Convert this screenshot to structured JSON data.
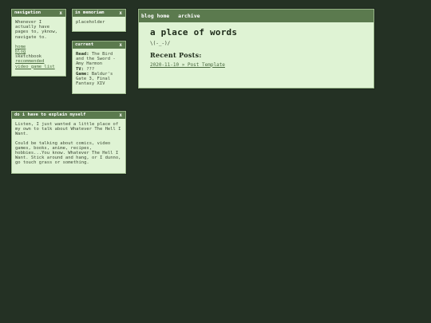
{
  "windows": {
    "navigation": {
      "title": "navigation",
      "close": "x",
      "intro": "Whenever I actually have pages to, yknow, navigate to.",
      "links": [
        "home",
        "blog",
        "sketchbook",
        "recommended",
        "video game list"
      ]
    },
    "memoriam": {
      "title": "in memoriam",
      "close": "x",
      "text": "placeholder"
    },
    "current": {
      "title": "current",
      "close": "x",
      "read_label": "Read:",
      "read_value": " The Bird and the Sword - Amy Harmon",
      "tv_label": "TV:",
      "tv_value": " ???",
      "game_label": "Game:",
      "game_value": " Baldur's Gate 3, Final Fantasy XIV"
    },
    "explain": {
      "title": "do i have to explain myself",
      "close": "x",
      "para1": "Listen, I just wanted a little place of my own to talk about Whatever The Hell I Want.",
      "para2": "Could be talking about comics, video games, books, anime, recipes, hobbies...You know. Whatever The Hell I Want. Stick around and hang, or I dunno, go touch grass or something."
    },
    "blog": {
      "tabs": [
        "blog home",
        "archive"
      ],
      "site_title": "a place of words",
      "kaomoji": "\\(-_-)/",
      "recent_heading": "Recent Posts:",
      "posts": [
        "2020-11-10 » Post Template"
      ]
    }
  },
  "colors": {
    "background": "#243124",
    "titlebar": "#5b7a4e",
    "window_bg": "#dff3d4",
    "link": "#4a6a3f"
  }
}
